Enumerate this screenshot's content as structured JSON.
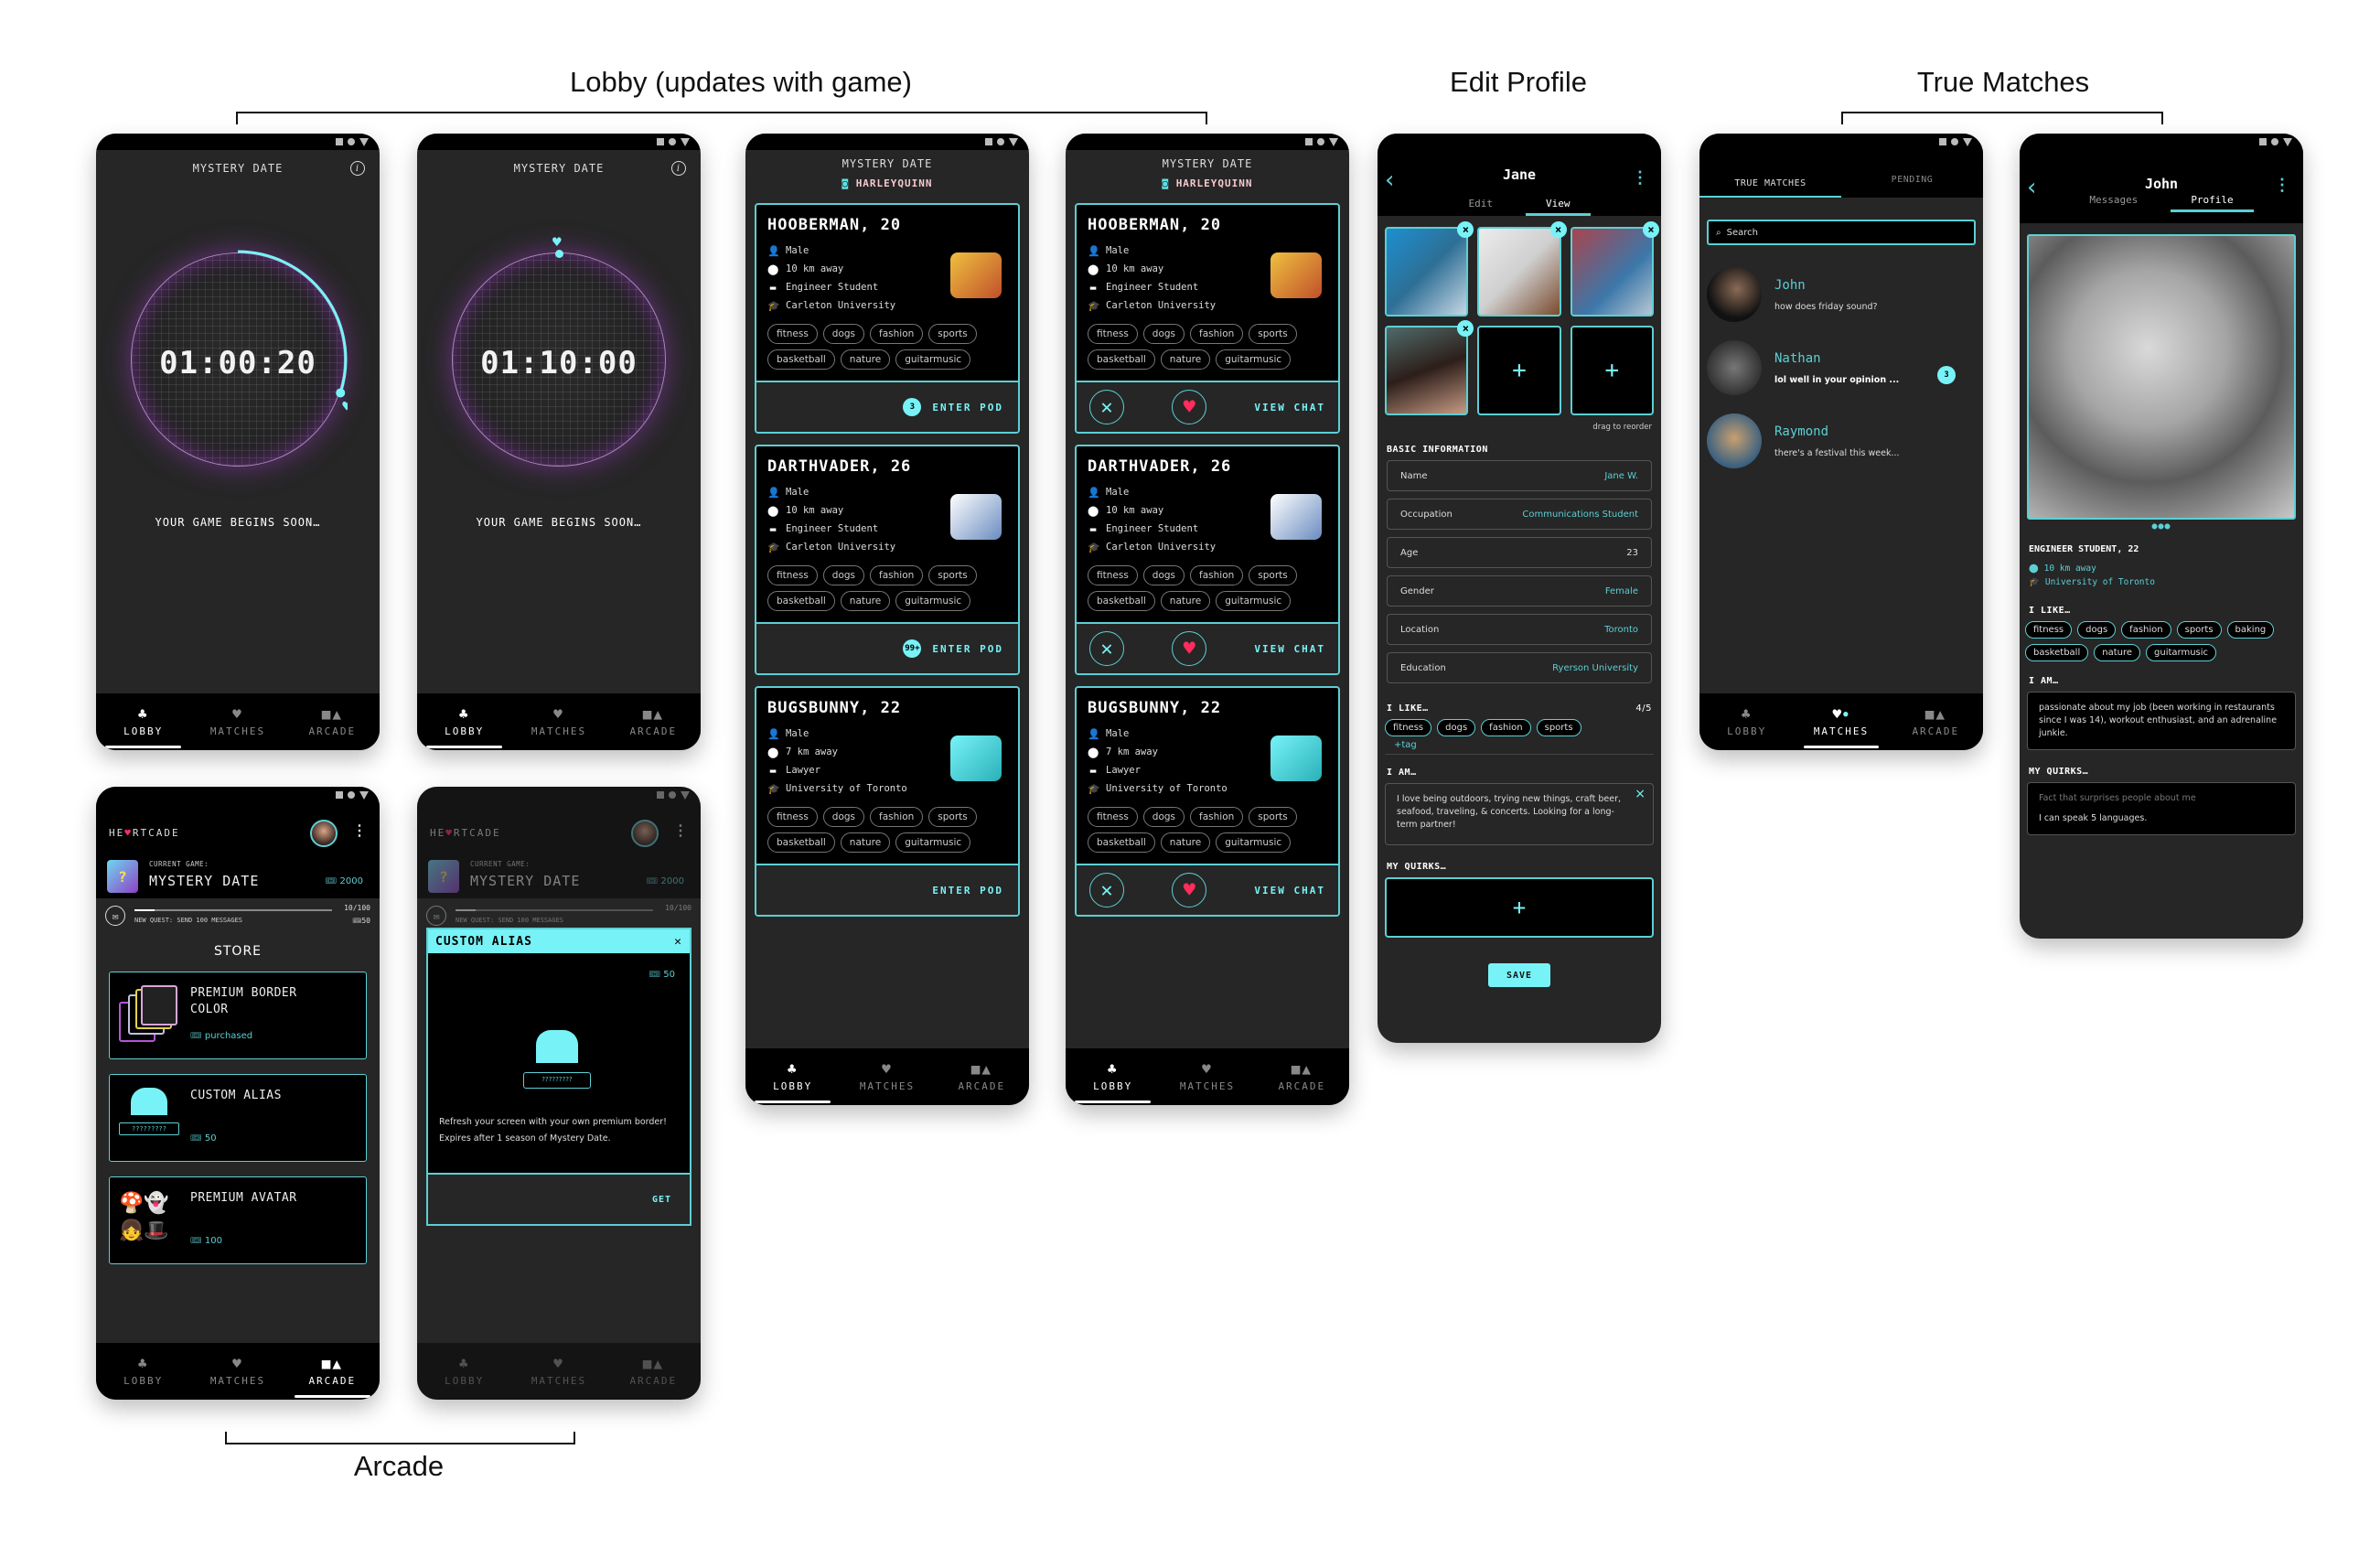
{
  "sections": {
    "lobby": "Lobby (updates with game)",
    "edit_profile": "Edit Profile",
    "true_matches": "True Matches",
    "arcade": "Arcade"
  },
  "nav": {
    "lobby": "LOBBY",
    "matches": "MATCHES",
    "arcade": "ARCADE"
  },
  "lobby_timer_1": {
    "title": "MYSTERY DATE",
    "timer": "01:00:20",
    "status": "YOUR GAME BEGINS SOON…",
    "progress_fraction": 0.3
  },
  "lobby_timer_2": {
    "title": "MYSTERY DATE",
    "timer": "01:10:00",
    "status": "YOUR GAME BEGINS SOON…",
    "progress_fraction": 0.0
  },
  "lobby_pods": {
    "title": "MYSTERY DATE",
    "alias": "HARLEYQUINN",
    "profiles": [
      {
        "name": "HOOBERMAN, 20",
        "gender": "Male",
        "distance": "10 km away",
        "occupation": "Engineer Student",
        "school": "Carleton University",
        "tags": [
          "fitness",
          "dogs",
          "fashion",
          "sports",
          "basketball",
          "nature",
          "guitarmusic"
        ],
        "pod_count": "3",
        "action": "ENTER POD"
      },
      {
        "name": "DARTHVADER, 26",
        "gender": "Male",
        "distance": "10 km away",
        "occupation": "Engineer Student",
        "school": "Carleton University",
        "tags": [
          "fitness",
          "dogs",
          "fashion",
          "sports",
          "basketball",
          "nature",
          "guitarmusic"
        ],
        "pod_count": "99+",
        "action": "ENTER POD"
      },
      {
        "name": "BUGSBUNNY, 22",
        "gender": "Male",
        "distance": "7 km away",
        "occupation": "Lawyer",
        "school": "University of Toronto",
        "tags": [
          "fitness",
          "dogs",
          "fashion",
          "sports",
          "basketball",
          "nature",
          "guitarmusic"
        ],
        "pod_count": "",
        "action": "ENTER POD"
      }
    ]
  },
  "lobby_chat": {
    "action": "VIEW CHAT"
  },
  "edit_profile": {
    "name": "Jane",
    "tab_edit": "Edit",
    "tab_view": "View",
    "drag_note": "drag to reorder",
    "basic_info_label": "BASIC INFORMATION",
    "fields": [
      {
        "label": "Name",
        "value": "Jane W."
      },
      {
        "label": "Occupation",
        "value": "Communications Student"
      },
      {
        "label": "Age",
        "value": "23"
      },
      {
        "label": "Gender",
        "value": "Female"
      },
      {
        "label": "Location",
        "value": "Toronto"
      },
      {
        "label": "Education",
        "value": "Ryerson University"
      }
    ],
    "likes_label": "I LIKE…",
    "likes_count": "4/5",
    "likes": [
      "fitness",
      "dogs",
      "fashion",
      "sports"
    ],
    "add_tag": "+tag",
    "iam_label": "I AM…",
    "bio": "I love being outdoors, trying new things, craft beer, seafood, traveling, & concerts. Looking for a long-term partner!",
    "quirks_label": "MY QUIRKS…",
    "save": "SAVE"
  },
  "true_matches": {
    "tab_true": "TRUE MATCHES",
    "tab_pending": "PENDING",
    "search_placeholder": "Search",
    "chats": [
      {
        "name": "John",
        "message": "how does friday sound?",
        "unread": ""
      },
      {
        "name": "Nathan",
        "message": "lol well in your opinion ...",
        "unread": "3"
      },
      {
        "name": "Raymond",
        "message": "there's a festival this week...",
        "unread": ""
      }
    ]
  },
  "john_profile": {
    "name": "John",
    "tab_messages": "Messages",
    "tab_profile": "Profile",
    "headline": "ENGINEER STUDENT, 22",
    "distance": "10 km away",
    "school": "University of Toronto",
    "likes_label": "I LIKE…",
    "likes": [
      "fitness",
      "dogs",
      "fashion",
      "sports",
      "baking",
      "basketball",
      "nature",
      "guitarmusic"
    ],
    "iam_label": "I AM…",
    "bio": "passionate about my job (been working in restaurants since I was 14), workout enthusiast, and an adrenaline junkie.",
    "quirks_label": "MY QUIRKS…",
    "quirk_prompt": "Fact that surprises people about me",
    "quirk_answer": "I can speak 5 languages."
  },
  "arcade": {
    "brand_pre": "HE",
    "brand_heart": "♥",
    "brand_post": "RTCADE",
    "current_label": "CURRENT GAME:",
    "current_game": "MYSTERY DATE",
    "tickets": "2000",
    "quest_progress": "10/100",
    "quest_fraction": 0.1,
    "quest_text": "NEW QUEST: SEND 100 MESSAGES",
    "quest_reward": "50",
    "store_title": "STORE",
    "items": [
      {
        "name": "PREMIUM BORDER COLOR",
        "price": "purchased"
      },
      {
        "name": "CUSTOM ALIAS",
        "price": "50",
        "alias_placeholder": "?????????"
      },
      {
        "name": "PREMIUM AVATAR",
        "price": "100"
      }
    ],
    "modal": {
      "title": "CUSTOM ALIAS",
      "price": "50",
      "alias_placeholder": "?????????",
      "description": "Refresh your screen with your own premium border! Expires after 1 season of Mystery Date.",
      "action": "GET"
    }
  },
  "colors": {
    "accent": "#77f3f7",
    "heart": "#ff2c5c",
    "bg": "#262626",
    "glow": "#a040c8"
  }
}
